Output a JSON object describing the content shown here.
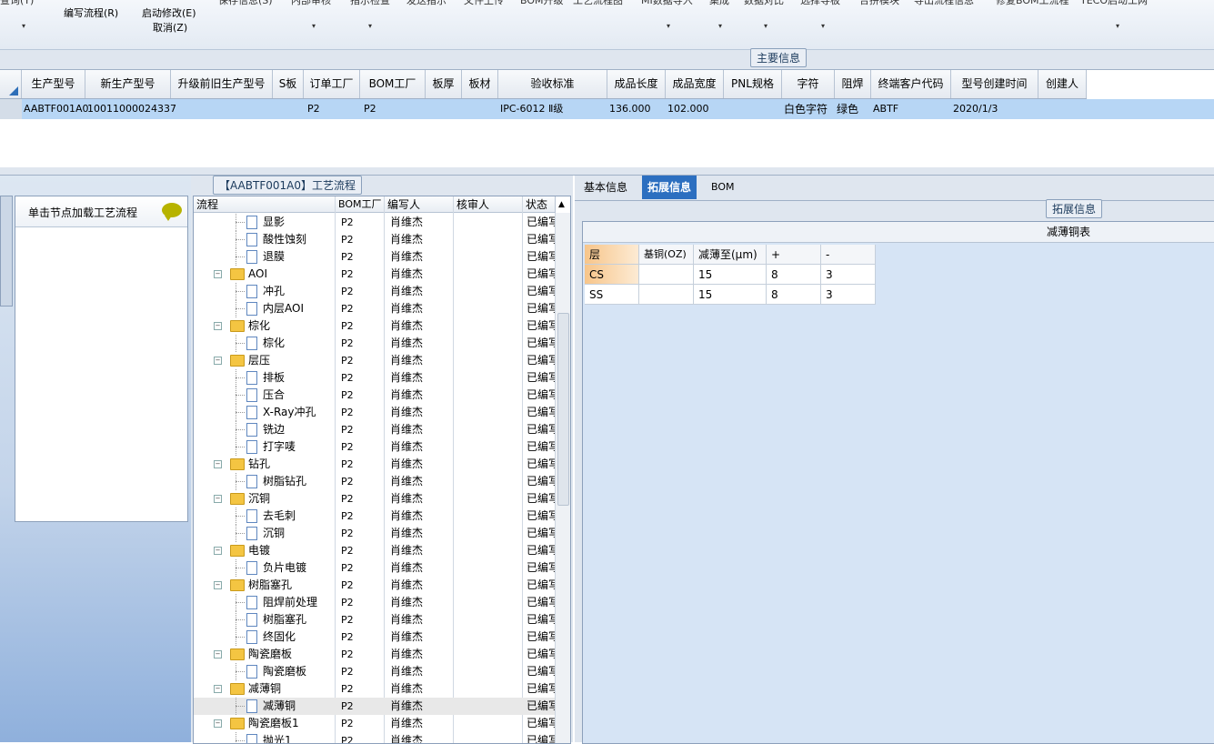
{
  "toolbar": {
    "top_partial": [
      "查询(Y)",
      "保存信息(S)",
      "内部审核",
      "指示检查",
      "发送指示",
      "文件上传",
      "BOM升级",
      "工艺流程图",
      "MI数据导入",
      "集成",
      "数据对比",
      "选择导板",
      "合拼模块",
      "导出流程信息",
      "修复BOM工流程",
      "TECO启动工网"
    ],
    "edit_flow": "编写流程(R)",
    "start_modify": "启动修改(E)",
    "cancel": "取消(Z)"
  },
  "main_info": {
    "legend": "主要信息"
  },
  "grid": {
    "headers": [
      "生产型号",
      "新生产型号",
      "升级前旧生产型号",
      "S板",
      "订单工厂",
      "BOM工厂",
      "板厚",
      "板材",
      "验收标准",
      "成品长度",
      "成品宽度",
      "PNL规格",
      "字符",
      "阻焊",
      "终端客户代码",
      "型号创建时间",
      "创建人"
    ],
    "row": {
      "prod_no": "AABTF001A0",
      "new_prod_no": "10011000024337",
      "old_prod_no": "",
      "s_board": "",
      "order_factory": "P2",
      "bom_factory": "P2",
      "thickness": "",
      "material": "",
      "standard": "IPC-6012 Ⅱ级",
      "length": "136.000",
      "width": "102.000",
      "pnl": "",
      "char": "白色字符",
      "mask": "绿色",
      "customer": "ABTF",
      "created": "2020/1/3",
      "creator": ""
    }
  },
  "left_panel": {
    "node_title": "单击节点加载工艺流程"
  },
  "flow": {
    "legend": "【AABTF001A0】工艺流程",
    "headers": {
      "flow": "流程",
      "bom": "BOM工厂",
      "writer": "编写人",
      "reviewer": "核审人",
      "status": "状态"
    },
    "rows": [
      {
        "label": "显影",
        "bom": "P2",
        "writer": "肖维杰",
        "status": "已编写",
        "level": 2
      },
      {
        "label": "酸性蚀刻",
        "bom": "P2",
        "writer": "肖维杰",
        "status": "已编写",
        "level": 2
      },
      {
        "label": "退膜",
        "bom": "P2",
        "writer": "肖维杰",
        "status": "已编写",
        "level": 2
      },
      {
        "label": "AOI",
        "bom": "P2",
        "writer": "肖维杰",
        "status": "已编写",
        "level": 1
      },
      {
        "label": "冲孔",
        "bom": "P2",
        "writer": "肖维杰",
        "status": "已编写",
        "level": 2
      },
      {
        "label": "内层AOI",
        "bom": "P2",
        "writer": "肖维杰",
        "status": "已编写",
        "level": 2
      },
      {
        "label": "棕化",
        "bom": "P2",
        "writer": "肖维杰",
        "status": "已编写",
        "level": 1
      },
      {
        "label": "棕化",
        "bom": "P2",
        "writer": "肖维杰",
        "status": "已编写",
        "level": 2
      },
      {
        "label": "层压",
        "bom": "P2",
        "writer": "肖维杰",
        "status": "已编写",
        "level": 1
      },
      {
        "label": "排板",
        "bom": "P2",
        "writer": "肖维杰",
        "status": "已编写",
        "level": 2
      },
      {
        "label": "压合",
        "bom": "P2",
        "writer": "肖维杰",
        "status": "已编写",
        "level": 2
      },
      {
        "label": "X-Ray冲孔",
        "bom": "P2",
        "writer": "肖维杰",
        "status": "已编写",
        "level": 2
      },
      {
        "label": "铣边",
        "bom": "P2",
        "writer": "肖维杰",
        "status": "已编写",
        "level": 2
      },
      {
        "label": "打字唛",
        "bom": "P2",
        "writer": "肖维杰",
        "status": "已编写",
        "level": 2
      },
      {
        "label": "钻孔",
        "bom": "P2",
        "writer": "肖维杰",
        "status": "已编写",
        "level": 1
      },
      {
        "label": "树脂钻孔",
        "bom": "P2",
        "writer": "肖维杰",
        "status": "已编写",
        "level": 2
      },
      {
        "label": "沉铜",
        "bom": "P2",
        "writer": "肖维杰",
        "status": "已编写",
        "level": 1
      },
      {
        "label": "去毛刺",
        "bom": "P2",
        "writer": "肖维杰",
        "status": "已编写",
        "level": 2
      },
      {
        "label": "沉铜",
        "bom": "P2",
        "writer": "肖维杰",
        "status": "已编写",
        "level": 2
      },
      {
        "label": "电镀",
        "bom": "P2",
        "writer": "肖维杰",
        "status": "已编写",
        "level": 1
      },
      {
        "label": "负片电镀",
        "bom": "P2",
        "writer": "肖维杰",
        "status": "已编写",
        "level": 2
      },
      {
        "label": "树脂塞孔",
        "bom": "P2",
        "writer": "肖维杰",
        "status": "已编写",
        "level": 1
      },
      {
        "label": "阻焊前处理",
        "bom": "P2",
        "writer": "肖维杰",
        "status": "已编写",
        "level": 2
      },
      {
        "label": "树脂塞孔",
        "bom": "P2",
        "writer": "肖维杰",
        "status": "已编写",
        "level": 2
      },
      {
        "label": "终固化",
        "bom": "P2",
        "writer": "肖维杰",
        "status": "已编写",
        "level": 2
      },
      {
        "label": "陶瓷磨板",
        "bom": "P2",
        "writer": "肖维杰",
        "status": "已编写",
        "level": 1
      },
      {
        "label": "陶瓷磨板",
        "bom": "P2",
        "writer": "肖维杰",
        "status": "已编写",
        "level": 2
      },
      {
        "label": "减薄铜",
        "bom": "P2",
        "writer": "肖维杰",
        "status": "已编写",
        "level": 1
      },
      {
        "label": "减薄铜",
        "bom": "P2",
        "writer": "肖维杰",
        "status": "已编写",
        "level": 2,
        "selected": true
      },
      {
        "label": "陶瓷磨板1",
        "bom": "P2",
        "writer": "肖维杰",
        "status": "已编写",
        "level": 1
      },
      {
        "label": "抛光1",
        "bom": "P2",
        "writer": "肖维杰",
        "status": "已编写",
        "level": 2
      }
    ]
  },
  "right_panel": {
    "tabs": [
      "基本信息",
      "拓展信息",
      "BOM"
    ],
    "active_tab": "拓展信息",
    "legend": "拓展信息",
    "table_title": "减薄铜表",
    "sub_headers": [
      "层",
      "基铜(OZ)",
      "减薄至(μm)",
      "+",
      "-"
    ],
    "sub_rows": [
      {
        "layer": "CS",
        "base": "",
        "to": "15",
        "plus": "8",
        "minus": "3"
      },
      {
        "layer": "SS",
        "base": "",
        "to": "15",
        "plus": "8",
        "minus": "3"
      }
    ]
  }
}
